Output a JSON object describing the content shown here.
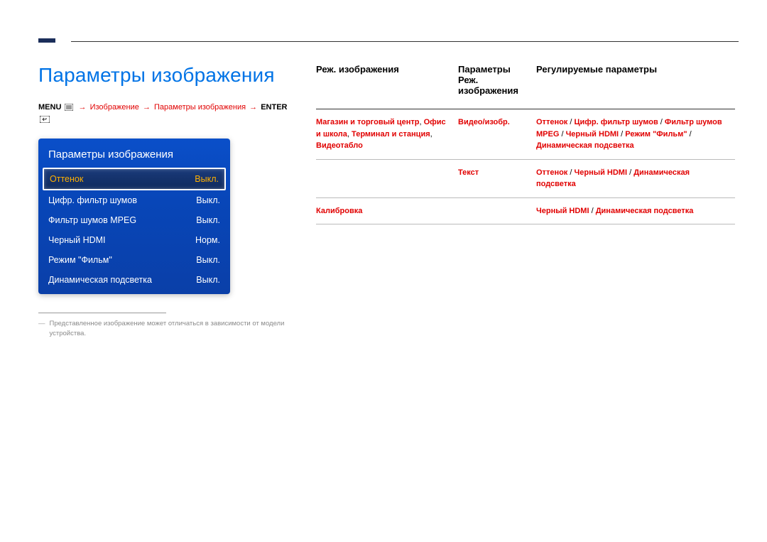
{
  "page_title": "Параметры изображения",
  "breadcrumb": {
    "menu_label": "MENU",
    "seg1": "Изображение",
    "seg2": "Параметры изображения",
    "enter_label": "ENTER",
    "arrow": "→"
  },
  "osd": {
    "title": "Параметры изображения",
    "rows": [
      {
        "label": "Оттенок",
        "value": "Выкл.",
        "selected": true
      },
      {
        "label": "Цифр. фильтр шумов",
        "value": "Выкл.",
        "selected": false
      },
      {
        "label": "Фильтр шумов MPEG",
        "value": "Выкл.",
        "selected": false
      },
      {
        "label": "Черный HDMI",
        "value": "Норм.",
        "selected": false
      },
      {
        "label": "Режим \"Фильм\"",
        "value": "Выкл.",
        "selected": false
      },
      {
        "label": "Динамическая подсветка",
        "value": "Выкл.",
        "selected": false
      }
    ]
  },
  "footnote": "Представленное изображение может отличаться в зависимости от модели устройства.",
  "table": {
    "headers": {
      "col1": "Реж. изображения",
      "col2": "Параметры Реж. изображения",
      "col3": "Регулируемые параметры"
    },
    "rows": [
      {
        "c1_parts": [
          {
            "t": "Магазин и торговый центр",
            "red": true
          },
          {
            "t": ", ",
            "red": false
          },
          {
            "t": "Офис и школа",
            "red": true
          },
          {
            "t": ", ",
            "red": false
          },
          {
            "t": "Терминал и станция",
            "red": true
          },
          {
            "t": ", ",
            "red": false
          },
          {
            "t": "Видеотабло",
            "red": true
          }
        ],
        "c2": "Видео/изобр.",
        "c3_parts": [
          {
            "t": "Оттенок",
            "red": true
          },
          {
            "t": " / "
          },
          {
            "t": "Цифр. фильтр шумов",
            "red": true
          },
          {
            "t": " / "
          },
          {
            "t": "Фильтр шумов MPEG",
            "red": true
          },
          {
            "t": " / "
          },
          {
            "t": "Черный HDMI",
            "red": true
          },
          {
            "t": " / "
          },
          {
            "t": "Режим \"Фильм\"",
            "red": true
          },
          {
            "t": " / "
          },
          {
            "t": "Динамическая подсветка",
            "red": true
          }
        ]
      },
      {
        "c1_parts": [],
        "c2": "Текст",
        "c3_parts": [
          {
            "t": "Оттенок",
            "red": true
          },
          {
            "t": " / "
          },
          {
            "t": "Черный HDMI",
            "red": true
          },
          {
            "t": " / "
          },
          {
            "t": "Динамическая подсветка",
            "red": true
          }
        ]
      },
      {
        "c1_parts": [
          {
            "t": "Калибровка",
            "red": true
          }
        ],
        "c2": "",
        "c3_parts": [
          {
            "t": "Черный HDMI",
            "red": true
          },
          {
            "t": " / "
          },
          {
            "t": "Динамическая подсветка",
            "red": true
          }
        ]
      }
    ]
  }
}
